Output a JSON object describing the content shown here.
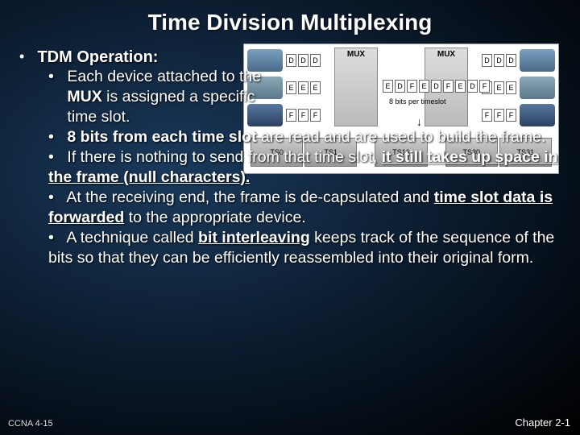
{
  "title": "Time Division Multiplexing",
  "outer_label": "TDM Operation:",
  "bullets": {
    "b1_pre": "Each device attached to the ",
    "b1_em": "MUX",
    "b1_post": " is assigned a specific time slot.",
    "b2_pre": "",
    "b2_em": "8 bits from each time slot",
    "b2_post": " are read and are used to build the frame.",
    "b3_pre": "If there is nothing to send from that time slot, ",
    "b3_em": "it still takes up space in the frame (null characters).",
    "b3_post": "",
    "b4_pre": "At the receiving end, the frame is de-capsulated and ",
    "b4_em": "time slot data is forwarded",
    "b4_post": " to the appropriate device.",
    "b5_pre": "A technique called ",
    "b5_em": "bit interleaving",
    "b5_post": " keeps track of the sequence of the bits so that they can be efficiently reassembled into their original form."
  },
  "diagram": {
    "mux_label": "MUX",
    "letters": {
      "d": "D",
      "e": "E",
      "f": "F"
    },
    "mid_caption": "8 bits per timeslot",
    "ts": {
      "ts0": "TS0",
      "ts1": "TS1",
      "ts16": "TS16",
      "ts30": "TS30",
      "ts31": "TS31",
      "dots": "..."
    }
  },
  "footer": {
    "left": "CCNA 4-15",
    "right": "Chapter 2-1"
  }
}
